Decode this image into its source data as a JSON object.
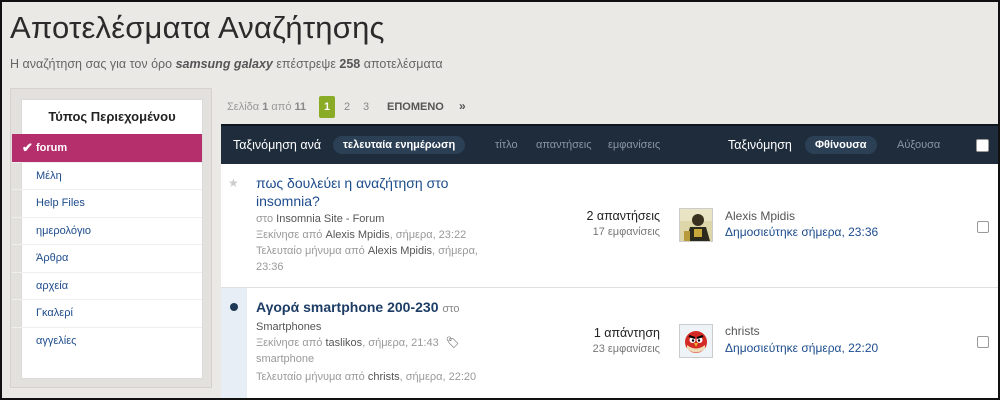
{
  "page": {
    "title": "Αποτελέσματα Αναζήτησης",
    "subtitle_prefix": "Η αναζήτηση σας για τον όρο",
    "search_term": "samsung galaxy",
    "subtitle_mid": "επέστρεψε",
    "result_count": "258",
    "subtitle_suffix": "αποτελέσματα"
  },
  "sidebar": {
    "header": "Τύπος Περιεχομένου",
    "items": [
      {
        "label": "forum",
        "active": true
      },
      {
        "label": "Μέλη"
      },
      {
        "label": "Help Files"
      },
      {
        "label": "ημερολόγιο"
      },
      {
        "label": "Άρθρα"
      },
      {
        "label": "αρχεία"
      },
      {
        "label": "Γκαλερί"
      },
      {
        "label": "αγγελίες"
      }
    ]
  },
  "pagination": {
    "info_prefix": "Σελίδα",
    "current": "1",
    "info_of": "από",
    "total": "11",
    "pages": [
      "1",
      "2",
      "3"
    ],
    "next_label": "ΕΠΟΜΕΝΟ",
    "last_label": "»"
  },
  "sortbar": {
    "sort_by_label": "Ταξινόμηση ανά",
    "options": [
      "τελευταία ενημέρωση",
      "τίτλο",
      "απαντήσεις",
      "εμφανίσεις"
    ],
    "order_label": "Ταξινόμηση",
    "order_options": [
      "Φθίνουσα",
      "Αύξουσα"
    ]
  },
  "topics": [
    {
      "title": "πως δουλεύει η αναζήτηση στο insomnia?",
      "forum_prefix": "στο",
      "forum": "Insomnia Site - Forum",
      "started_prefix": "Ξεκίνησε από",
      "starter": "Alexis Mpidis",
      "started_time": ", σήμερα, 23:22",
      "last_prefix": "Τελευταίο μήνυμα από",
      "last_poster": "Alexis Mpidis",
      "last_time": ", σήμερα,",
      "last_time2": "23:36",
      "replies": "2 απαντήσεις",
      "views": "17 εμφανίσεις",
      "last_user": "Alexis Mpidis",
      "last_date": "Δημοσιεύτηκε σήμερα, 23:36",
      "avatar_icon": "user-avatar-icon"
    },
    {
      "title": "Αγορά smartphone 200-230",
      "title_in": "στο",
      "forum": "Smartphones",
      "started_prefix": "Ξεκίνησε από",
      "starter": "taslikos",
      "started_time": ", σήμερα, 21:43",
      "tag": "smartphone",
      "last_prefix": "Τελευταίο μήνυμα από",
      "last_poster": "christs",
      "last_time": ", σήμερα, 22:20",
      "replies": "1 απάντηση",
      "views": "23 εμφανίσεις",
      "last_user": "christs",
      "last_date": "Δημοσιεύτηκε σήμερα, 22:20",
      "avatar_icon": "angry-bird-avatar-icon"
    }
  ],
  "colors": {
    "accent_active": "#b52f6d",
    "pagination_current": "#8aab25",
    "sortbar_bg": "#1e2c3c",
    "link": "#1d4c8c"
  }
}
